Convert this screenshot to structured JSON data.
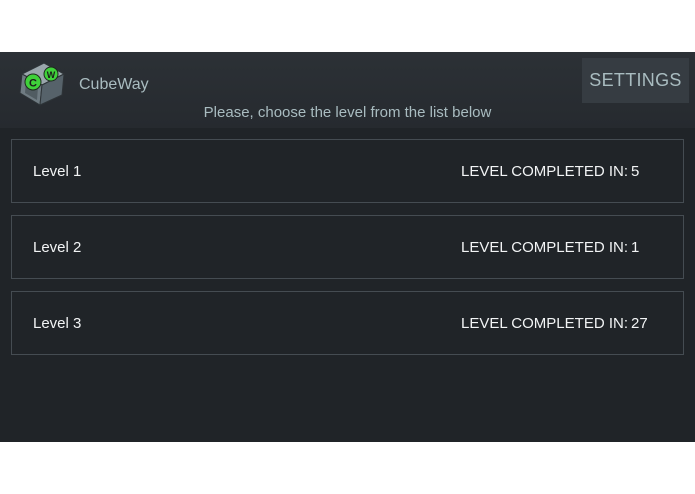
{
  "app": {
    "title": "CubeWay",
    "icon": "cube-logo-icon",
    "logo_letters": [
      "C",
      "W"
    ]
  },
  "actionbar": {
    "settings_label": "SETTINGS"
  },
  "subtitle": "Please, choose the level from the list below",
  "levels": [
    {
      "name": "Level 1",
      "status_label": "LEVEL COMPLETED IN:",
      "status_value": "5"
    },
    {
      "name": "Level 2",
      "status_label": "LEVEL COMPLETED IN:",
      "status_value": "1"
    },
    {
      "name": "Level 3",
      "status_label": "LEVEL COMPLETED IN:",
      "status_value": "27"
    }
  ],
  "colors": {
    "background": "#202428",
    "actionbar": "#2a2f34",
    "accent_text": "#a9bcc0",
    "logo_green": "#3fd13a"
  }
}
